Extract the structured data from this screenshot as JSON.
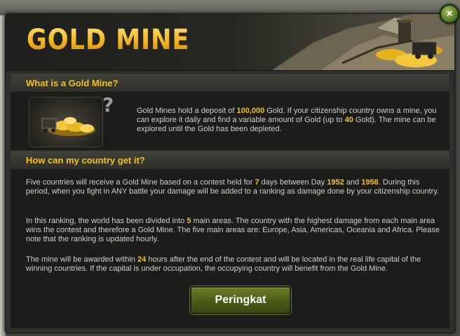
{
  "colors": {
    "accent": "#f0c21a",
    "panel": "#1c1d1b",
    "button": "#4a5b16"
  },
  "header": {
    "title": "GOLD MINE"
  },
  "close": {
    "icon": "close-icon",
    "glyph": "×"
  },
  "section1": {
    "heading": "What is a Gold Mine?",
    "text": {
      "t1": "Gold Mines hold a deposit of ",
      "v1": "100,000",
      "t2": " Gold. If your citizenship country owns a mine, you can explore it daily and find a variable amount of Gold (up to ",
      "v2": "40",
      "t3": " Gold). The mine can be explored until the Gold has been depleted."
    }
  },
  "section2": {
    "heading": "How can my country get it?",
    "para1": {
      "t1": "Five countries will receive a Gold Mine based on a contest held for ",
      "v1": "7",
      "t2": " days between Day ",
      "v2": "1952",
      "t3": " and ",
      "v3": "1958",
      "t4": ". During this period, when you fight in ANY battle your damage will be added to a ranking as damage done by your citizenship country."
    },
    "para2": {
      "t1": "In this ranking, the world has been divided into ",
      "v1": "5",
      "t2": " main areas. The country with the highest damage from each main area wins the contest and therefore a Gold Mine. The five main areas are: Europe, Asia, Americas, Oceania and Africa. Please note that the ranking is updated hourly."
    },
    "para3": {
      "t1": "The mine will be awarded within ",
      "v1": "24",
      "t2": " hours after the end of the contest and will be located in the real life capital of the winning countries. If the capital is under occupation, the occupying country will benefit from the Gold Mine."
    }
  },
  "button": {
    "label": "Peringkat"
  }
}
